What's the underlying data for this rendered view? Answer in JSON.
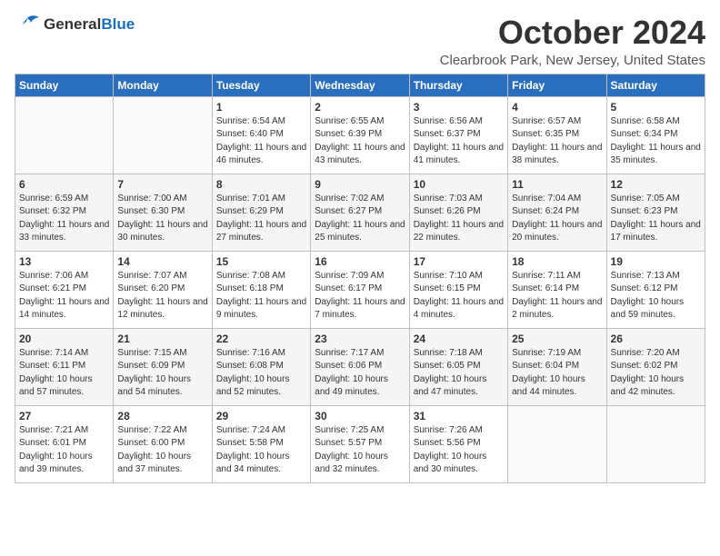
{
  "header": {
    "logo_general": "General",
    "logo_blue": "Blue",
    "month_title": "October 2024",
    "location": "Clearbrook Park, New Jersey, United States"
  },
  "weekdays": [
    "Sunday",
    "Monday",
    "Tuesday",
    "Wednesday",
    "Thursday",
    "Friday",
    "Saturday"
  ],
  "weeks": [
    [
      {
        "day": "",
        "info": ""
      },
      {
        "day": "",
        "info": ""
      },
      {
        "day": "1",
        "info": "Sunrise: 6:54 AM\nSunset: 6:40 PM\nDaylight: 11 hours and 46 minutes."
      },
      {
        "day": "2",
        "info": "Sunrise: 6:55 AM\nSunset: 6:39 PM\nDaylight: 11 hours and 43 minutes."
      },
      {
        "day": "3",
        "info": "Sunrise: 6:56 AM\nSunset: 6:37 PM\nDaylight: 11 hours and 41 minutes."
      },
      {
        "day": "4",
        "info": "Sunrise: 6:57 AM\nSunset: 6:35 PM\nDaylight: 11 hours and 38 minutes."
      },
      {
        "day": "5",
        "info": "Sunrise: 6:58 AM\nSunset: 6:34 PM\nDaylight: 11 hours and 35 minutes."
      }
    ],
    [
      {
        "day": "6",
        "info": "Sunrise: 6:59 AM\nSunset: 6:32 PM\nDaylight: 11 hours and 33 minutes."
      },
      {
        "day": "7",
        "info": "Sunrise: 7:00 AM\nSunset: 6:30 PM\nDaylight: 11 hours and 30 minutes."
      },
      {
        "day": "8",
        "info": "Sunrise: 7:01 AM\nSunset: 6:29 PM\nDaylight: 11 hours and 27 minutes."
      },
      {
        "day": "9",
        "info": "Sunrise: 7:02 AM\nSunset: 6:27 PM\nDaylight: 11 hours and 25 minutes."
      },
      {
        "day": "10",
        "info": "Sunrise: 7:03 AM\nSunset: 6:26 PM\nDaylight: 11 hours and 22 minutes."
      },
      {
        "day": "11",
        "info": "Sunrise: 7:04 AM\nSunset: 6:24 PM\nDaylight: 11 hours and 20 minutes."
      },
      {
        "day": "12",
        "info": "Sunrise: 7:05 AM\nSunset: 6:23 PM\nDaylight: 11 hours and 17 minutes."
      }
    ],
    [
      {
        "day": "13",
        "info": "Sunrise: 7:06 AM\nSunset: 6:21 PM\nDaylight: 11 hours and 14 minutes."
      },
      {
        "day": "14",
        "info": "Sunrise: 7:07 AM\nSunset: 6:20 PM\nDaylight: 11 hours and 12 minutes."
      },
      {
        "day": "15",
        "info": "Sunrise: 7:08 AM\nSunset: 6:18 PM\nDaylight: 11 hours and 9 minutes."
      },
      {
        "day": "16",
        "info": "Sunrise: 7:09 AM\nSunset: 6:17 PM\nDaylight: 11 hours and 7 minutes."
      },
      {
        "day": "17",
        "info": "Sunrise: 7:10 AM\nSunset: 6:15 PM\nDaylight: 11 hours and 4 minutes."
      },
      {
        "day": "18",
        "info": "Sunrise: 7:11 AM\nSunset: 6:14 PM\nDaylight: 11 hours and 2 minutes."
      },
      {
        "day": "19",
        "info": "Sunrise: 7:13 AM\nSunset: 6:12 PM\nDaylight: 10 hours and 59 minutes."
      }
    ],
    [
      {
        "day": "20",
        "info": "Sunrise: 7:14 AM\nSunset: 6:11 PM\nDaylight: 10 hours and 57 minutes."
      },
      {
        "day": "21",
        "info": "Sunrise: 7:15 AM\nSunset: 6:09 PM\nDaylight: 10 hours and 54 minutes."
      },
      {
        "day": "22",
        "info": "Sunrise: 7:16 AM\nSunset: 6:08 PM\nDaylight: 10 hours and 52 minutes."
      },
      {
        "day": "23",
        "info": "Sunrise: 7:17 AM\nSunset: 6:06 PM\nDaylight: 10 hours and 49 minutes."
      },
      {
        "day": "24",
        "info": "Sunrise: 7:18 AM\nSunset: 6:05 PM\nDaylight: 10 hours and 47 minutes."
      },
      {
        "day": "25",
        "info": "Sunrise: 7:19 AM\nSunset: 6:04 PM\nDaylight: 10 hours and 44 minutes."
      },
      {
        "day": "26",
        "info": "Sunrise: 7:20 AM\nSunset: 6:02 PM\nDaylight: 10 hours and 42 minutes."
      }
    ],
    [
      {
        "day": "27",
        "info": "Sunrise: 7:21 AM\nSunset: 6:01 PM\nDaylight: 10 hours and 39 minutes."
      },
      {
        "day": "28",
        "info": "Sunrise: 7:22 AM\nSunset: 6:00 PM\nDaylight: 10 hours and 37 minutes."
      },
      {
        "day": "29",
        "info": "Sunrise: 7:24 AM\nSunset: 5:58 PM\nDaylight: 10 hours and 34 minutes."
      },
      {
        "day": "30",
        "info": "Sunrise: 7:25 AM\nSunset: 5:57 PM\nDaylight: 10 hours and 32 minutes."
      },
      {
        "day": "31",
        "info": "Sunrise: 7:26 AM\nSunset: 5:56 PM\nDaylight: 10 hours and 30 minutes."
      },
      {
        "day": "",
        "info": ""
      },
      {
        "day": "",
        "info": ""
      }
    ]
  ]
}
